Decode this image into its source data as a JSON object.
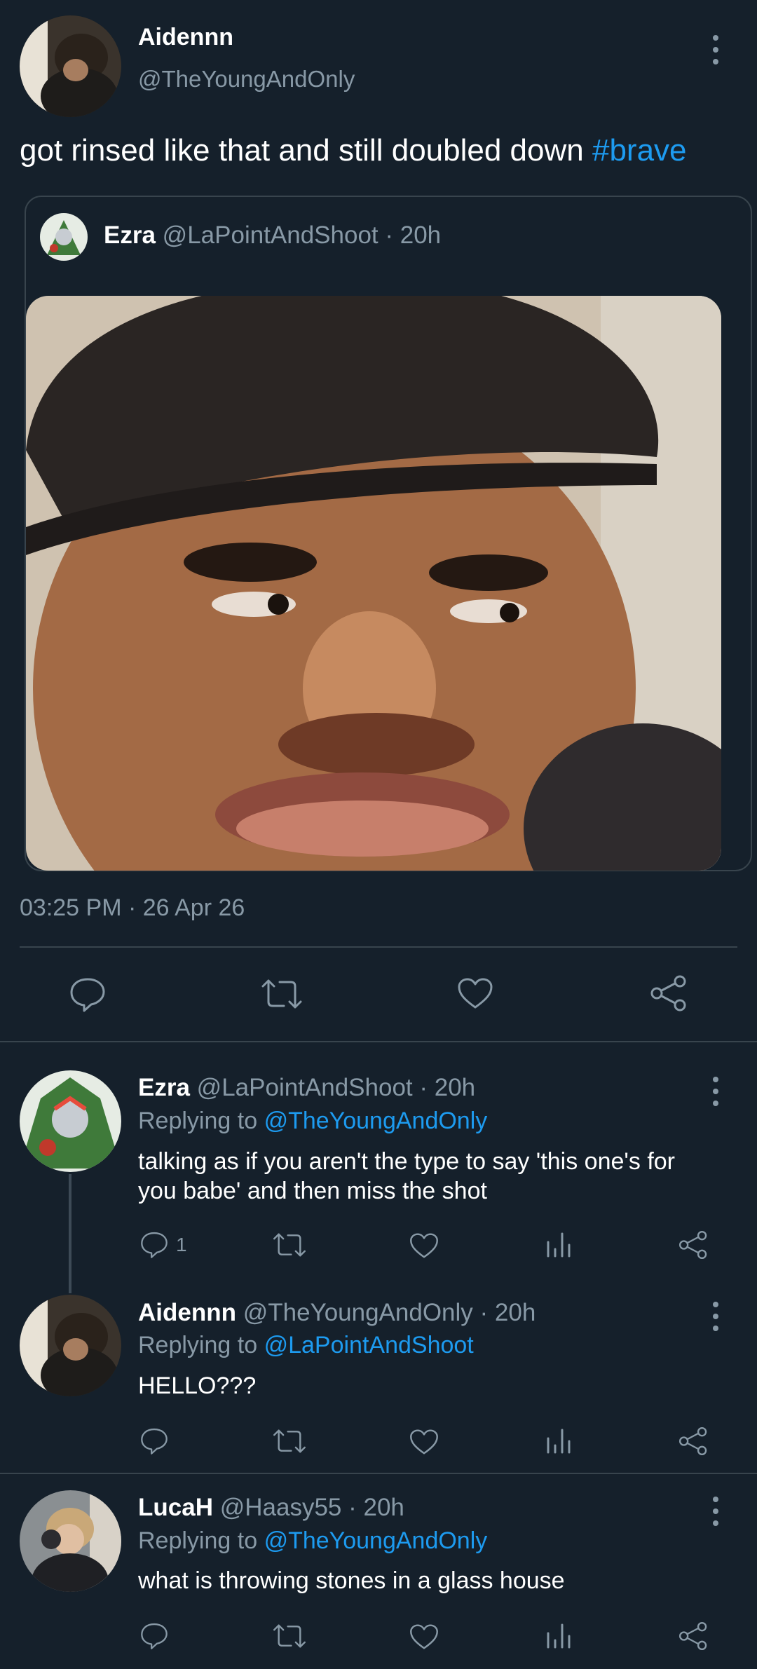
{
  "main_tweet": {
    "display_name": "Aidennn",
    "handle": "@TheYoungAndOnly",
    "text": "got rinsed like that and still doubled down",
    "hashtag": "#brave",
    "timestamp": "03:25 PM · 26 Apr 26"
  },
  "quoted_tweet": {
    "display_name": "Ezra",
    "handle_time": "@LaPointAndShoot · 20h"
  },
  "replies": [
    {
      "display_name": "Ezra",
      "handle_time": "@LaPointAndShoot · 20h",
      "replying_label": "Replying to",
      "replying_to": "@TheYoungAndOnly",
      "text": "talking as if you aren't the type to say 'this one's for you babe' and then miss the shot",
      "reply_count": "1"
    },
    {
      "display_name": "Aidennn",
      "handle_time": "@TheYoungAndOnly · 20h",
      "replying_label": "Replying to",
      "replying_to": "@LaPointAndShoot",
      "text": "HELLO???"
    },
    {
      "display_name": "LucaH",
      "handle_time": "@Haasy55 · 20h",
      "replying_label": "Replying to",
      "replying_to": "@TheYoungAndOnly",
      "text": "what is throwing stones in a glass house"
    }
  ],
  "icons": {
    "reply": "speech-bubble-icon",
    "retweet": "retweet-arrows-icon",
    "like": "heart-icon",
    "share": "share-nodes-icon",
    "analytics": "bar-chart-icon",
    "more": "vertical-dots-icon"
  },
  "colors": {
    "background": "#15202b",
    "accent": "#1d9bf0",
    "muted": "#8899a6",
    "divider": "#38444d"
  }
}
